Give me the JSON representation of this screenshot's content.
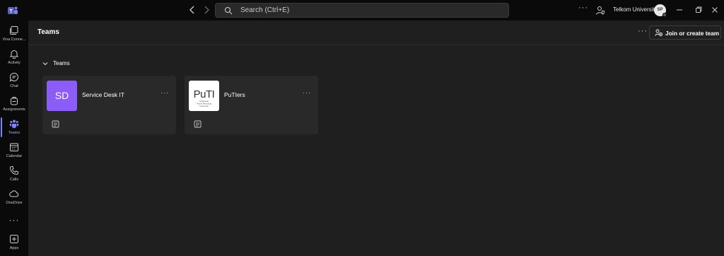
{
  "titlebar": {
    "search_placeholder": "Search (Ctrl+E)",
    "more_label": "···",
    "org_name": "Telkom University",
    "avatar_initials": "SP"
  },
  "rail": {
    "items": [
      {
        "label": "Viva Conne..."
      },
      {
        "label": "Activity"
      },
      {
        "label": "Chat"
      },
      {
        "label": "Assignments"
      },
      {
        "label": "Teams"
      },
      {
        "label": "Calendar"
      },
      {
        "label": "Calls"
      },
      {
        "label": "OneDrive"
      },
      {
        "label": "Apps"
      }
    ],
    "more_label": "···"
  },
  "header": {
    "title": "Teams",
    "more_label": "···",
    "join_label": "Join or create team"
  },
  "section": {
    "title": "Teams"
  },
  "teams": [
    {
      "name": "Service Desk IT",
      "tile_text": "SD",
      "tile_color": "#8b5cf6",
      "more_label": "···"
    },
    {
      "name": "PuTIers",
      "logo_text": "PuTI",
      "logo_sub1": "Direktorat",
      "logo_sub2": "Pusat Teknologi",
      "logo_sub3": "Informasi",
      "more_label": "···"
    }
  ],
  "colors": {
    "accent": "#7f85f5",
    "background": "#1f1f1f",
    "rail": "#0a0a0a",
    "card": "#292929"
  }
}
